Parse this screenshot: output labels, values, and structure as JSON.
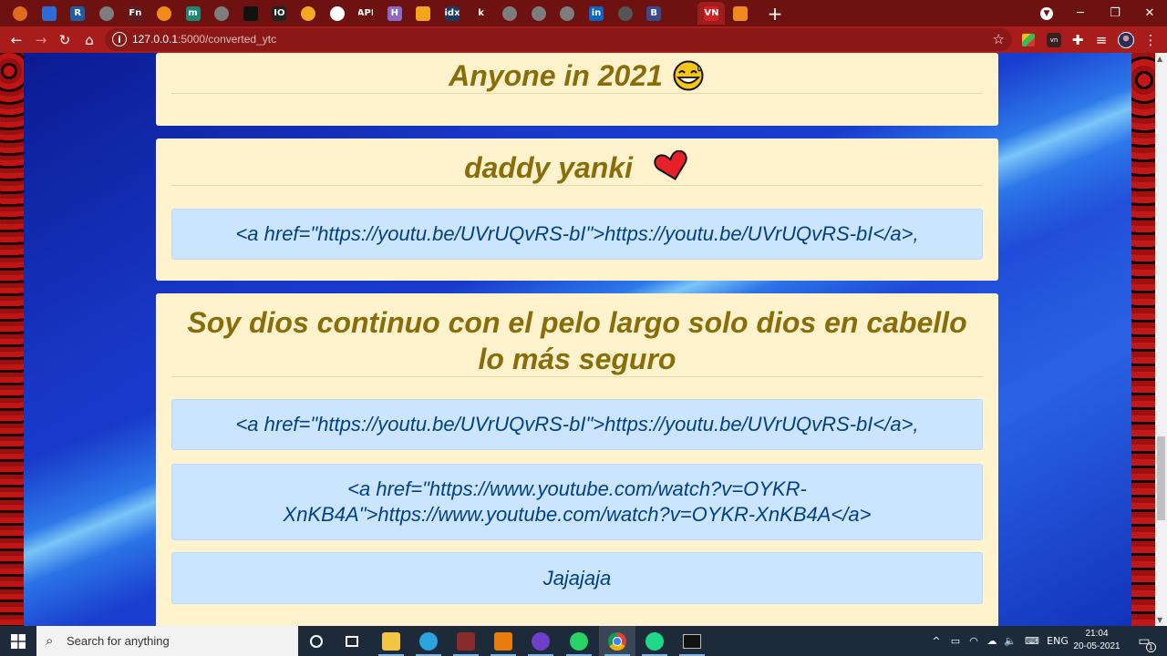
{
  "browser": {
    "tabs": [
      {
        "icon": "blender-ring-icon",
        "text": "",
        "bg": "#e06b1a",
        "active": false
      },
      {
        "icon": "swift-bird-icon",
        "text": "",
        "bg": "#2c6cd6",
        "active": false
      },
      {
        "icon": "r-letter-icon",
        "text": "R",
        "bg": "#1d5ea8",
        "active": false
      },
      {
        "icon": "blocked-circle-icon",
        "text": "",
        "bg": "#7d7d7d",
        "active": false
      },
      {
        "icon": "fn-letters-icon",
        "text": "Fn",
        "bg": "#5b1d1d",
        "active": false
      },
      {
        "icon": "orange-circle-icon",
        "text": "",
        "bg": "#f28b1c",
        "active": false
      },
      {
        "icon": "teal-m-icon",
        "text": "m",
        "bg": "#1b8a74",
        "active": false
      },
      {
        "icon": "blocked-circle-icon",
        "text": "",
        "bg": "#7d7d7d",
        "active": false
      },
      {
        "icon": "dark-box-icon",
        "text": "",
        "bg": "#111111",
        "active": false
      },
      {
        "icon": "io-box-icon",
        "text": "IO",
        "bg": "#222222",
        "active": false
      },
      {
        "icon": "flame-icon",
        "text": "",
        "bg": "#f5a623",
        "active": false
      },
      {
        "icon": "github-icon",
        "text": "",
        "bg": "#ffffff",
        "active": false
      },
      {
        "icon": "api-text-icon",
        "text": "API",
        "bg": "#6e1111",
        "active": false
      },
      {
        "icon": "h-letter-icon",
        "text": "H",
        "bg": "#8e6ac8",
        "active": false
      },
      {
        "icon": "k-orange-icon",
        "text": "",
        "bg": "#f3a51b",
        "active": false
      },
      {
        "icon": "idx-box-icon",
        "text": "idx",
        "bg": "#1e3a5f",
        "active": false
      },
      {
        "icon": "k-blue-icon",
        "text": "k",
        "bg": "#6e1111",
        "active": false
      },
      {
        "icon": "blocked-circle-icon",
        "text": "",
        "bg": "#7d7d7d",
        "active": false
      },
      {
        "icon": "blocked-circle-icon",
        "text": "",
        "bg": "#7d7d7d",
        "active": false
      },
      {
        "icon": "blocked-circle-icon",
        "text": "",
        "bg": "#7d7d7d",
        "active": false
      },
      {
        "icon": "linkedin-icon",
        "text": "in",
        "bg": "#0a66c2",
        "active": false
      },
      {
        "icon": "avatar-photo-icon",
        "text": "",
        "bg": "#555555",
        "active": false
      },
      {
        "icon": "b-letter-icon",
        "text": "B",
        "bg": "#3b4a8a",
        "active": false
      },
      {
        "icon": "speaker-icon",
        "text": "",
        "bg": "#6e1111",
        "active": false
      },
      {
        "icon": "mv-logo-icon",
        "text": "VN",
        "bg": "#d42020",
        "active": true
      },
      {
        "icon": "book-icon",
        "text": "",
        "bg": "#f08a1c",
        "active": false
      }
    ],
    "url": {
      "host": "127.0.0.1",
      "path": ":5000/converted_ytc"
    }
  },
  "posts": [
    {
      "title": "Anyone in 2021",
      "emoji": "grinning-sweat-face-icon",
      "links": []
    },
    {
      "title": "daddy yanki",
      "emoji": "red-heart-icon",
      "links": [
        "<a href=\"https://youtu.be/UVrUQvRS-bI\">https://youtu.be/UVrUQvRS-bI</a>,"
      ]
    },
    {
      "title": "Soy dios continuo con el pelo largo solo dios en cabello lo más seguro",
      "emoji": "",
      "links": [
        "<a href=\"https://youtu.be/UVrUQvRS-bI\">https://youtu.be/UVrUQvRS-bI</a>,",
        "<a href=\"https://www.youtube.com/watch?v=OYKR-XnKB4A\">https://www.youtube.com/watch?v=OYKR-XnKB4A</a>",
        "Jajajaja"
      ]
    }
  ],
  "taskbar": {
    "search_placeholder": "Search for anything",
    "apps": [
      "cortana-circle-icon",
      "task-view-icon",
      "file-explorer-icon",
      "telegram-icon",
      "game-icon",
      "blender-icon",
      "github-desktop-icon",
      "whatsapp-icon",
      "chrome-icon",
      "pycharm-icon",
      "terminal-icon"
    ],
    "lang": "ENG",
    "time": "21:04",
    "date": "20-05-2021",
    "notifications": "1"
  }
}
